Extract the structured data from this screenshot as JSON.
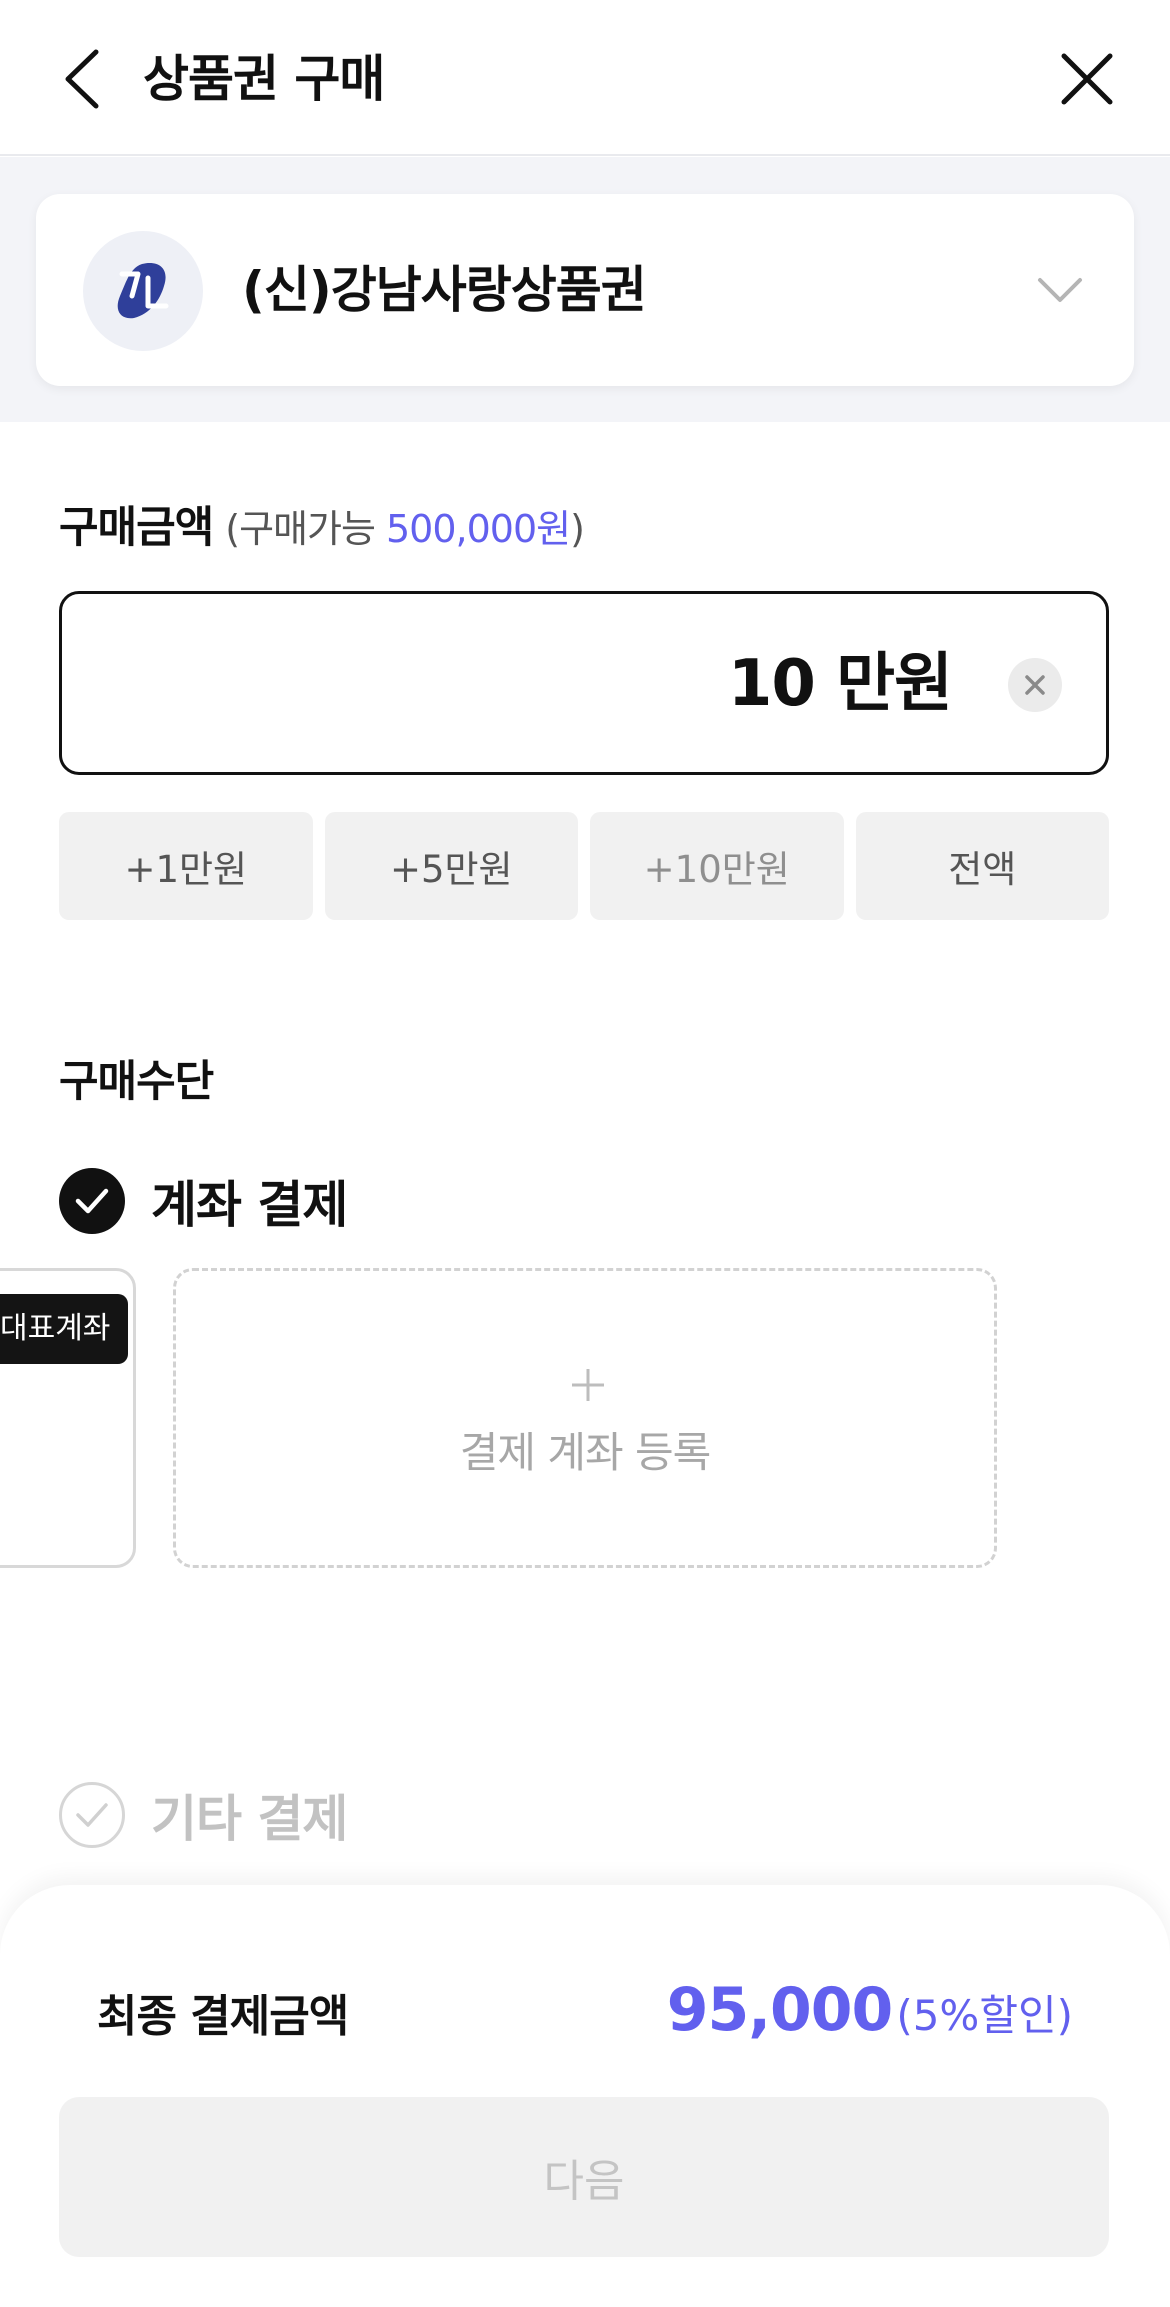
{
  "header": {
    "title": "상품권 구매",
    "back_icon": "chevron-left-icon",
    "close_icon": "close-icon"
  },
  "voucher_selector": {
    "name": "(신)강남사랑상품권",
    "logo_icon": "gangnam-logo-icon",
    "dropdown_icon": "chevron-down-icon"
  },
  "amount": {
    "label": "구매금액",
    "sub_open": "(구매가능 ",
    "limit": "500,000원",
    "sub_close": ")",
    "value": "10 만원",
    "quick_buttons": [
      "+1만원",
      "+5만원",
      "+10만원",
      "전액"
    ]
  },
  "payment_method": {
    "label": "구매수단",
    "account_option": "계좌 결제",
    "rep_badge": "대표계좌",
    "add_account_label": "결제 계좌 등록",
    "other_option": "기타 결제"
  },
  "summary": {
    "label": "최종 결제금액",
    "amount": "95,000",
    "discount": "(5%할인)",
    "next_button": "다음"
  },
  "colors": {
    "accent": "#6260ee",
    "logo_blue": "#2f3f9a",
    "background_band": "#f3f4f8"
  }
}
